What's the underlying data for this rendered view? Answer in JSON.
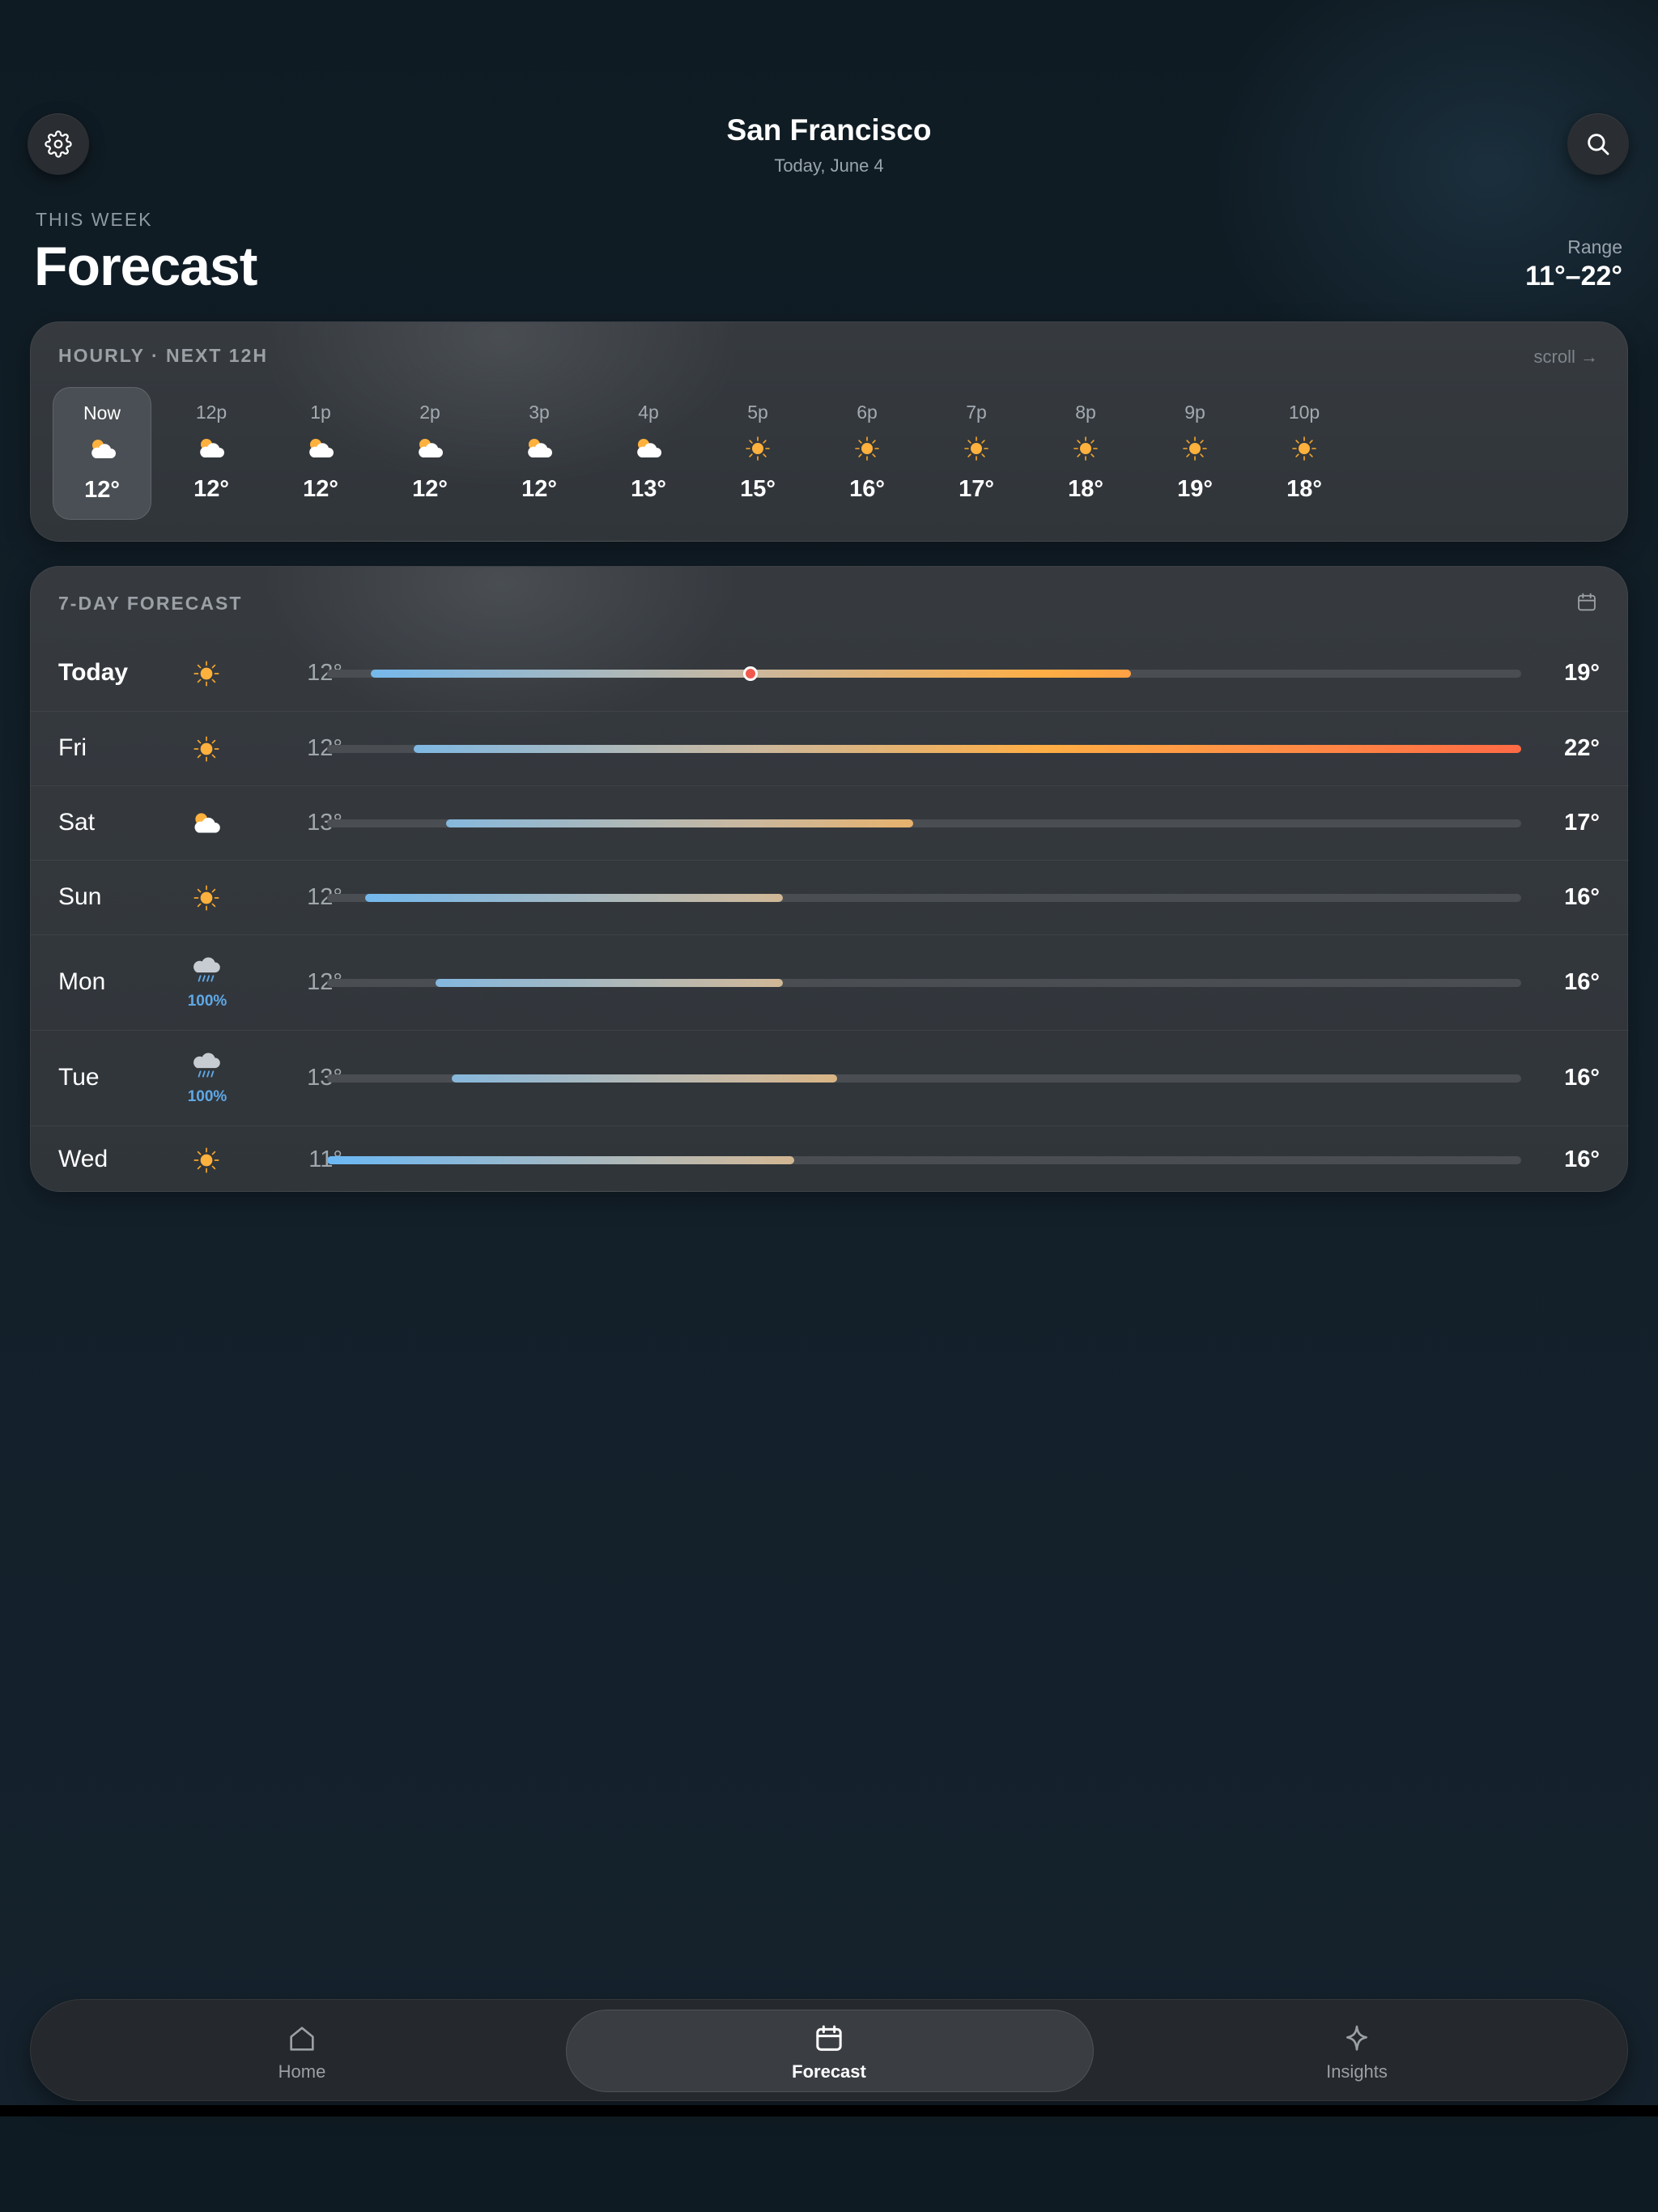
{
  "header": {
    "city": "San Francisco",
    "date": "Today, June 4",
    "settings_icon": "gear-icon",
    "search_icon": "search-icon"
  },
  "intro": {
    "eyebrow": "THIS WEEK",
    "title": "Forecast",
    "range_label": "Range",
    "range_value": "11°–22°"
  },
  "hourly": {
    "title": "HOURLY · NEXT 12H",
    "scroll_hint": "scroll →",
    "hours": [
      {
        "label": "Now",
        "icon": "partly-cloudy",
        "temp": "12°",
        "selected": true
      },
      {
        "label": "12p",
        "icon": "partly-cloudy",
        "temp": "12°"
      },
      {
        "label": "1p",
        "icon": "partly-cloudy",
        "temp": "12°"
      },
      {
        "label": "2p",
        "icon": "partly-cloudy",
        "temp": "12°"
      },
      {
        "label": "3p",
        "icon": "partly-cloudy",
        "temp": "12°"
      },
      {
        "label": "4p",
        "icon": "partly-cloudy",
        "temp": "13°"
      },
      {
        "label": "5p",
        "icon": "sunny",
        "temp": "15°"
      },
      {
        "label": "6p",
        "icon": "sunny",
        "temp": "16°"
      },
      {
        "label": "7p",
        "icon": "sunny",
        "temp": "17°"
      },
      {
        "label": "8p",
        "icon": "sunny",
        "temp": "18°"
      },
      {
        "label": "9p",
        "icon": "sunny",
        "temp": "19°"
      },
      {
        "label": "10p",
        "icon": "sunny",
        "temp": "18°"
      }
    ]
  },
  "daily": {
    "title": "7-DAY FORECAST",
    "calendar_icon": "calendar-icon",
    "scale": {
      "min": 11,
      "max": 22
    },
    "days": [
      {
        "day": "Today",
        "icon": "sunny",
        "low": "12°",
        "high": "19°",
        "low_val": 11.4,
        "high_val": 18.4,
        "now_val": 14.9
      },
      {
        "day": "Fri",
        "icon": "sunny",
        "low": "12°",
        "high": "22°",
        "low_val": 11.8,
        "high_val": 22
      },
      {
        "day": "Sat",
        "icon": "partly-cloudy",
        "low": "13°",
        "high": "17°",
        "low_val": 12.1,
        "high_val": 16.4
      },
      {
        "day": "Sun",
        "icon": "sunny",
        "low": "12°",
        "high": "16°",
        "low_val": 11.35,
        "high_val": 15.2
      },
      {
        "day": "Mon",
        "icon": "rain",
        "precip": "100%",
        "low": "12°",
        "high": "16°",
        "low_val": 12.0,
        "high_val": 15.2
      },
      {
        "day": "Tue",
        "icon": "rain",
        "precip": "100%",
        "low": "13°",
        "high": "16°",
        "low_val": 12.15,
        "high_val": 15.7
      },
      {
        "day": "Wed",
        "icon": "sunny",
        "low": "11°",
        "high": "16°",
        "low_val": 11.0,
        "high_val": 15.3
      }
    ]
  },
  "tabs": [
    {
      "label": "Home",
      "icon": "home-icon",
      "active": false
    },
    {
      "label": "Forecast",
      "icon": "calendar-icon",
      "active": true
    },
    {
      "label": "Insights",
      "icon": "sparkle-icon",
      "active": false
    }
  ],
  "colors": {
    "background": "#111d26",
    "card": "#33373c",
    "cold": "#6bb8f5",
    "mild": "#c9b8a0",
    "warm": "#ffae45",
    "hot": "#ff6a45",
    "precip": "#5fa8e6"
  }
}
